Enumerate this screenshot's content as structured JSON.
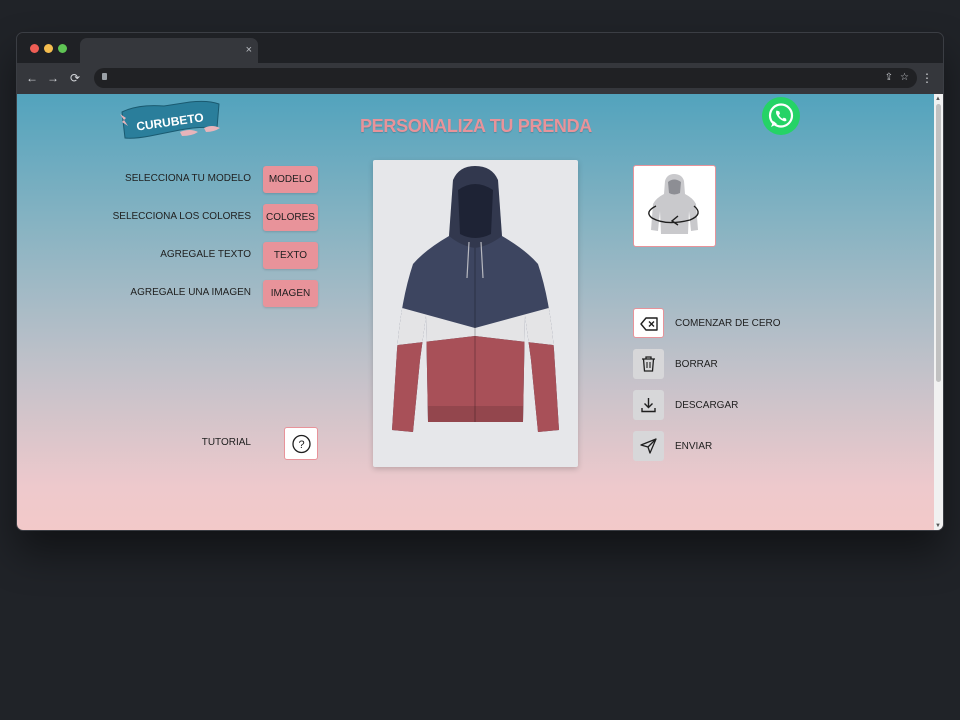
{
  "browser": {
    "tab_close": "×",
    "nav_back": "←",
    "nav_forward": "→",
    "nav_reload": "⟳",
    "share_icon": "⇪",
    "star_icon": "☆",
    "menu_icon": "⋮"
  },
  "header": {
    "logo_text": "CURUBETO",
    "title": "PERSONALIZA TU PRENDA"
  },
  "options": [
    {
      "label": "SELECCIONA TU MODELO",
      "button": "MODELO"
    },
    {
      "label": "SELECCIONA LOS COLORES",
      "button": "COLORES"
    },
    {
      "label": "AGREGALE TEXTO",
      "button": "TEXTO"
    },
    {
      "label": "AGREGALE UNA IMAGEN",
      "button": "IMAGEN"
    }
  ],
  "tutorial": {
    "label": "TUTORIAL",
    "icon": "?"
  },
  "actions": [
    {
      "label": "COMENZAR DE CERO",
      "icon": "backspace-icon"
    },
    {
      "label": "BORRAR",
      "icon": "trash-icon"
    },
    {
      "label": "DESCARGAR",
      "icon": "download-icon"
    },
    {
      "label": "ENVIAR",
      "icon": "send-icon"
    }
  ],
  "hoodie_colors": {
    "top": "#3d4560",
    "middle": "#e4e4e6",
    "bottom": "#a85058"
  },
  "colors": {
    "accent": "#e8939a",
    "title": "#e8939a",
    "whatsapp": "#25d366"
  }
}
